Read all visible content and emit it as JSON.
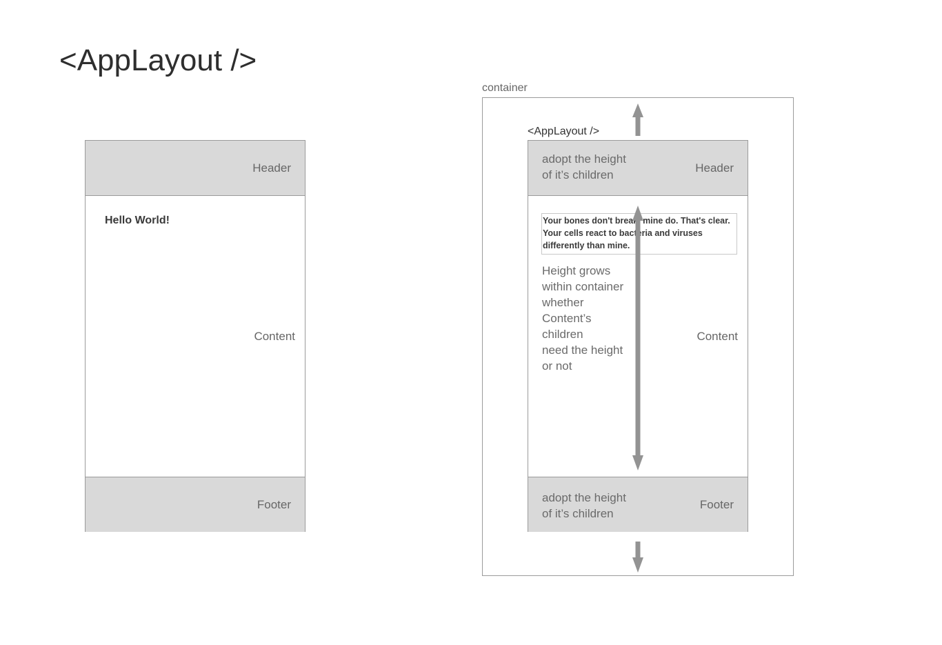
{
  "title": "<AppLayout />",
  "left": {
    "header": "Header",
    "content": "Content",
    "content_text": "Hello World!",
    "footer": "Footer"
  },
  "right": {
    "container_label": "container",
    "applayout_label": "<AppLayout />",
    "header": "Header",
    "header_note": [
      "adopt the height",
      "of it’s children"
    ],
    "content": "Content",
    "content_quote": [
      "Your bones don't break, mine do. That's clear.",
      "Your cells react to bacteria and viruses",
      "differently than mine."
    ],
    "content_note": [
      "Height grows",
      "within container",
      "whether",
      "Content’s",
      "children",
      "need the height",
      "or not"
    ],
    "footer": "Footer",
    "footer_note": [
      "adopt the height",
      "of it’s children"
    ]
  },
  "colors": {
    "gray_fill": "#d9d9d9",
    "border": "#9a9a9a",
    "arrow": "#939393"
  }
}
